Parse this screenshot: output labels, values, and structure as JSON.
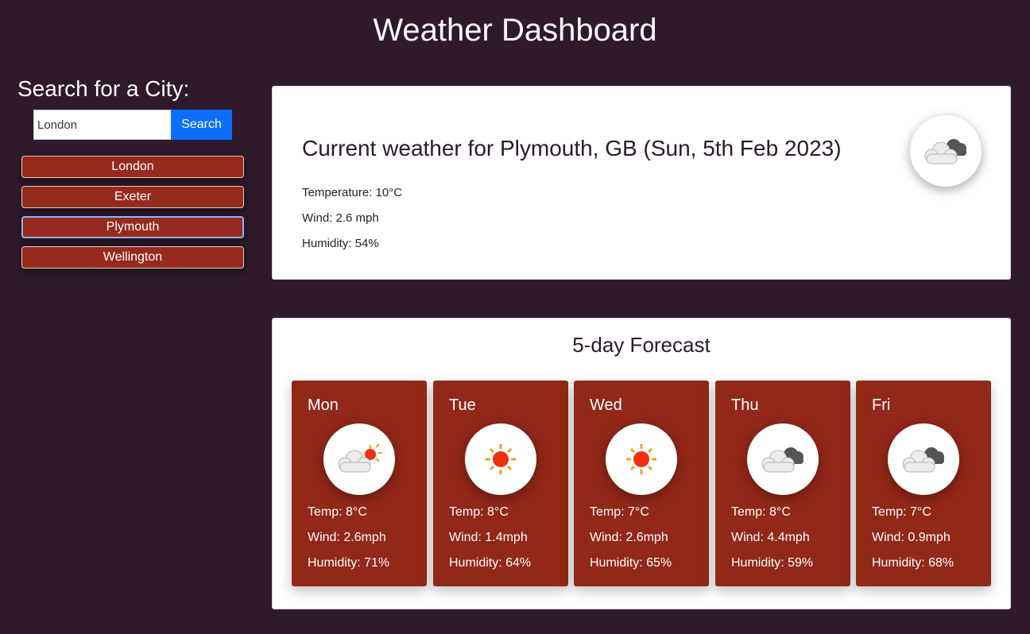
{
  "page": {
    "title": "Weather Dashboard"
  },
  "sidebar": {
    "heading": "Search for a City:",
    "search": {
      "value": "London",
      "button_label": "Search"
    },
    "history": [
      {
        "label": "London"
      },
      {
        "label": "Exeter"
      },
      {
        "label": "Plymouth"
      },
      {
        "label": "Wellington"
      }
    ]
  },
  "current": {
    "title": "Current weather for Plymouth, GB (Sun, 5th Feb 2023)",
    "temperature": "Temperature: 10°C",
    "wind": "Wind: 2.6 mph",
    "humidity": "Humidity: 54%",
    "icon": "cloudy-icon"
  },
  "forecast": {
    "title": "5-day Forecast",
    "days": [
      {
        "day": "Mon",
        "icon": "partly-cloudy-sun-icon",
        "temp": "Temp: 8°C",
        "wind": "Wind: 2.6mph",
        "humidity": "Humidity: 71%"
      },
      {
        "day": "Tue",
        "icon": "sun-icon",
        "temp": "Temp: 8°C",
        "wind": "Wind: 1.4mph",
        "humidity": "Humidity: 64%"
      },
      {
        "day": "Wed",
        "icon": "sun-icon",
        "temp": "Temp: 7°C",
        "wind": "Wind: 2.6mph",
        "humidity": "Humidity: 65%"
      },
      {
        "day": "Thu",
        "icon": "cloudy-icon",
        "temp": "Temp: 8°C",
        "wind": "Wind: 4.4mph",
        "humidity": "Humidity: 59%"
      },
      {
        "day": "Fri",
        "icon": "cloudy-icon",
        "temp": "Temp: 7°C",
        "wind": "Wind: 0.9mph",
        "humidity": "Humidity: 68%"
      }
    ]
  },
  "colors": {
    "background": "#2e1a2b",
    "accent_red": "#922818",
    "search_button": "#0d6efd"
  }
}
